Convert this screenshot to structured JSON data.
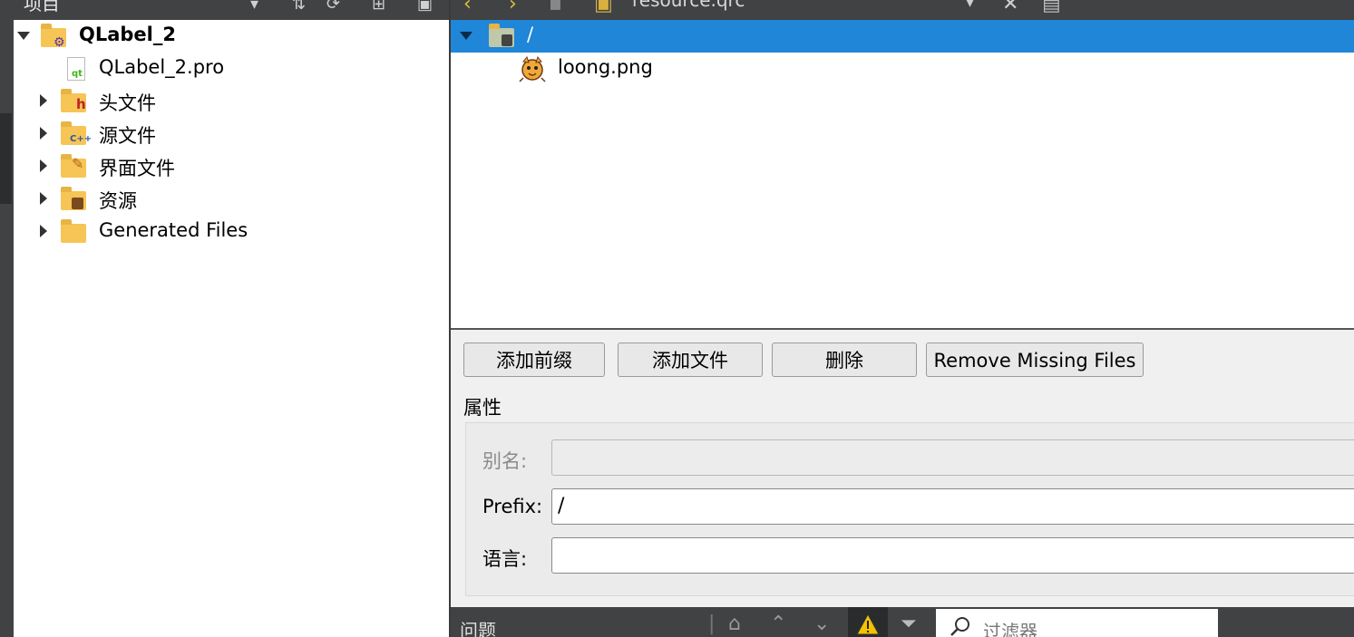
{
  "project_pane": {
    "title": "项目",
    "tree": [
      {
        "label": "QLabel_2",
        "bold": true,
        "expanded": true,
        "icon": "project-folder-icon"
      },
      {
        "label": "QLabel_2.pro",
        "icon": "pro-file-icon"
      },
      {
        "label": "头文件",
        "icon": "header-folder-icon"
      },
      {
        "label": "源文件",
        "icon": "source-folder-icon"
      },
      {
        "label": "界面文件",
        "icon": "forms-folder-icon"
      },
      {
        "label": "资源",
        "icon": "resources-folder-icon"
      },
      {
        "label": "Generated Files",
        "icon": "folder-icon"
      }
    ]
  },
  "editor": {
    "filename": "resource.qrc",
    "resource_tree": {
      "prefix": "/",
      "files": [
        {
          "label": "loong.png",
          "icon": "tiger-image-icon"
        }
      ]
    },
    "buttons": {
      "add_prefix": "添加前缀",
      "add_files": "添加文件",
      "remove": "删除",
      "remove_missing": "Remove Missing Files"
    },
    "properties": {
      "title": "属性",
      "alias_label": "别名:",
      "alias_value": "",
      "prefix_label": "Prefix:",
      "prefix_value": "/",
      "language_label": "语言:",
      "language_value": ""
    }
  },
  "issues_bar": {
    "title": "问题",
    "filter_placeholder": "过滤器"
  },
  "colors": {
    "selection": "#1f86d8",
    "toolbar_dark": "#404244",
    "folder_yellow": "#f6c555"
  }
}
